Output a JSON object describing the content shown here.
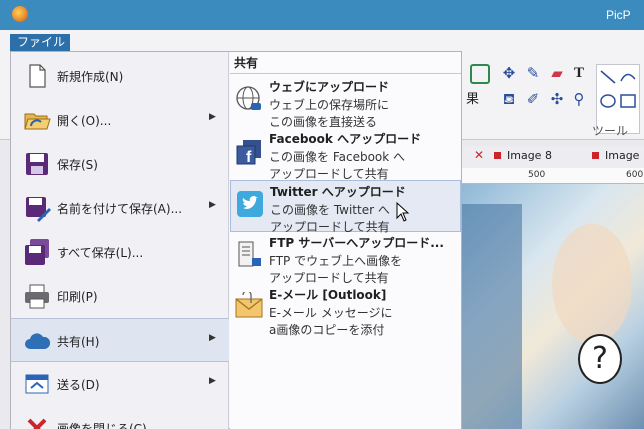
{
  "app": {
    "title": "PicP"
  },
  "ribbon": {
    "effects_label": "果",
    "tools_label": "ツール",
    "tool_text_glyph": "T"
  },
  "tabs": [
    {
      "label": "Image 8"
    },
    {
      "label": "Image"
    }
  ],
  "ruler": {
    "marks": [
      "500",
      "600"
    ]
  },
  "file_menu": {
    "button_label": "ファイル",
    "items": [
      {
        "label": "新規作成(N)",
        "icon": "new-document-icon",
        "submenu": false
      },
      {
        "label": "開く(O)...",
        "icon": "open-folder-icon",
        "submenu": true
      },
      {
        "label": "保存(S)",
        "icon": "save-disk-icon",
        "submenu": false
      },
      {
        "label": "名前を付けて保存(A)...",
        "icon": "save-as-icon",
        "submenu": true
      },
      {
        "label": "すべて保存(L)...",
        "icon": "save-all-icon",
        "submenu": false
      },
      {
        "label": "印刷(P)",
        "icon": "printer-icon",
        "submenu": false
      },
      {
        "label": "共有(H)",
        "icon": "cloud-share-icon",
        "submenu": true,
        "active": true
      },
      {
        "label": "送る(D)",
        "icon": "send-icon",
        "submenu": true
      },
      {
        "label": "画像を閉じる(C)",
        "icon": "close-image-icon",
        "submenu": false
      }
    ]
  },
  "share_panel": {
    "header": "共有",
    "items": [
      {
        "title": "ウェブにアップロード",
        "desc1": "ウェブ上の保存場所に",
        "desc2": "この画像を直接送る",
        "icon": "web-globe-icon"
      },
      {
        "title": "Facebook へアップロード",
        "desc1": "この画像を Facebook へ",
        "desc2": "アップロードして共有",
        "icon": "facebook-icon"
      },
      {
        "title": "Twitter へアップロード",
        "desc1": "この画像を Twitter へ",
        "desc2": "アップロードして共有",
        "icon": "twitter-icon",
        "hover": true
      },
      {
        "title": "FTP サーバーへアップロード...",
        "desc1": "FTP でウェブ上へ画像を",
        "desc2": "アップロードして共有",
        "icon": "ftp-server-icon"
      },
      {
        "title": "E-メール [Outlook]",
        "desc1": "E-メール メッセージに",
        "desc2": "a画像のコピーを添付",
        "icon": "email-icon"
      }
    ]
  },
  "colors": {
    "titlebar": "#3b8bbf",
    "file_button": "#2c6fa9",
    "tab_marker": "#c9252a",
    "hover_bg": "#e4e9f3"
  }
}
